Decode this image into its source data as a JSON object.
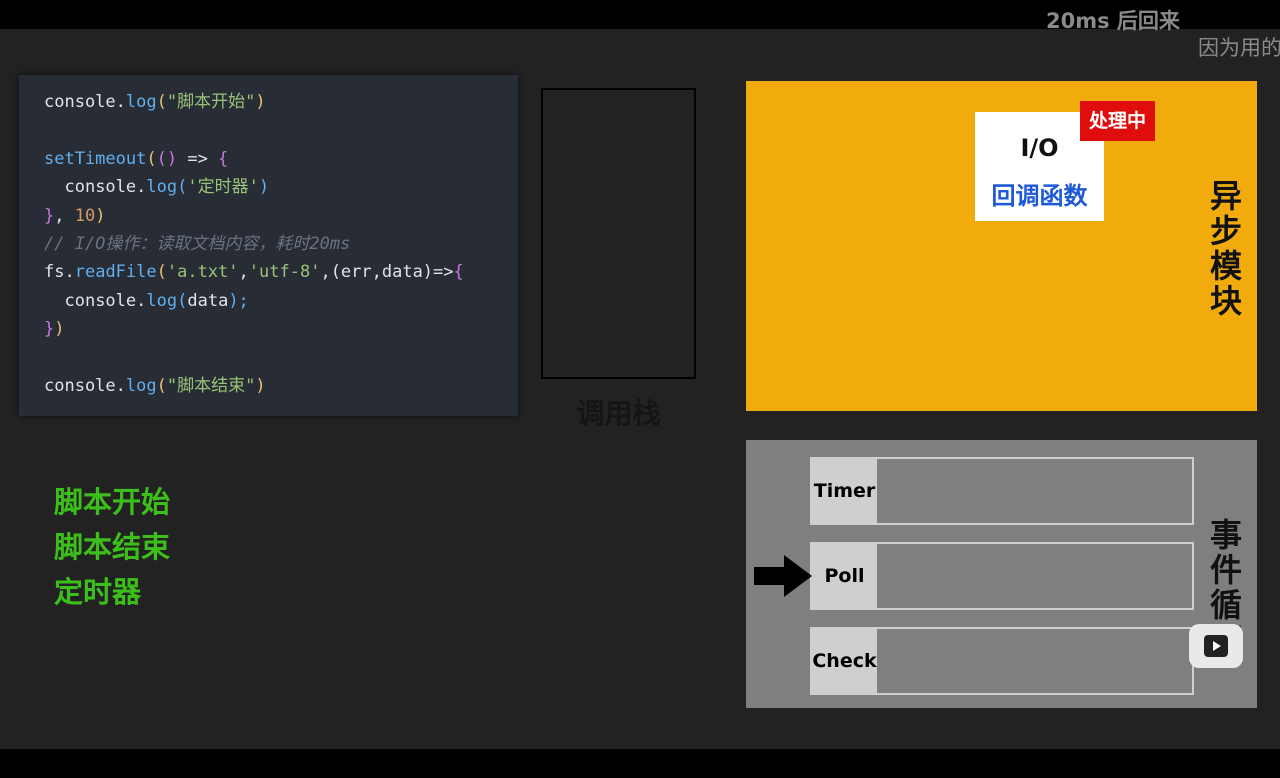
{
  "subtitles": {
    "line1": "20ms  后回来",
    "line2": "因为用的"
  },
  "code": {
    "line1": {
      "obj": "console",
      "dot": ".",
      "fn": "log",
      "open": "(",
      "str": "\"脚本开始\"",
      "close": ")"
    },
    "line3": {
      "fn": "setTimeout",
      "open": "(",
      "params": "()",
      "arrow": " => ",
      "brace": "{"
    },
    "line4": {
      "indent": "  ",
      "obj": "console",
      "dot": ".",
      "fn": "log",
      "open": "(",
      "str": "'定时器'",
      "close": ")"
    },
    "line5": {
      "brace": "}",
      "comma": ", ",
      "num": "10",
      "close": ")"
    },
    "line6": {
      "comment": "// I/O操作：读取文档内容，耗时20ms"
    },
    "line7": {
      "obj": "fs",
      "dot": ".",
      "fn": "readFile",
      "open": "(",
      "str1": "'a.txt'",
      "comma1": ",",
      "str2": "'utf-8'",
      "comma2": ",",
      "params": "(err,data)",
      "arrow": "=>",
      "brace": "{"
    },
    "line8": {
      "indent": "  ",
      "obj": "console",
      "dot": ".",
      "fn": "log",
      "open": "(",
      "arg": "data",
      "close": ");"
    },
    "line9": {
      "brace": "}",
      "close": ")"
    },
    "line11": {
      "obj": "console",
      "dot": ".",
      "fn": "log",
      "open": "(",
      "str": "\"脚本结束\"",
      "close": ")"
    }
  },
  "output": [
    "脚本开始",
    "脚本结束",
    "定时器"
  ],
  "call_stack": {
    "label": "调用栈"
  },
  "async_module": {
    "label": "异步模块",
    "io_title": "I/O",
    "io_callback": "回调函数",
    "status_badge": "处理中"
  },
  "event_loop": {
    "label": "事件循环",
    "phases": [
      {
        "name": "Timer"
      },
      {
        "name": "Poll"
      },
      {
        "name": "Check"
      }
    ],
    "current_phase": "Poll"
  },
  "colors": {
    "output_text": "#3cbf1a",
    "async_bg": "#f1ab0c",
    "badge_bg": "#e00d0d",
    "callback_text": "#1e5ad6",
    "event_loop_bg": "#7f7f7f",
    "code_bg": "#282c34"
  },
  "icons": {
    "arrow": "right-arrow-icon",
    "play": "play-icon"
  }
}
